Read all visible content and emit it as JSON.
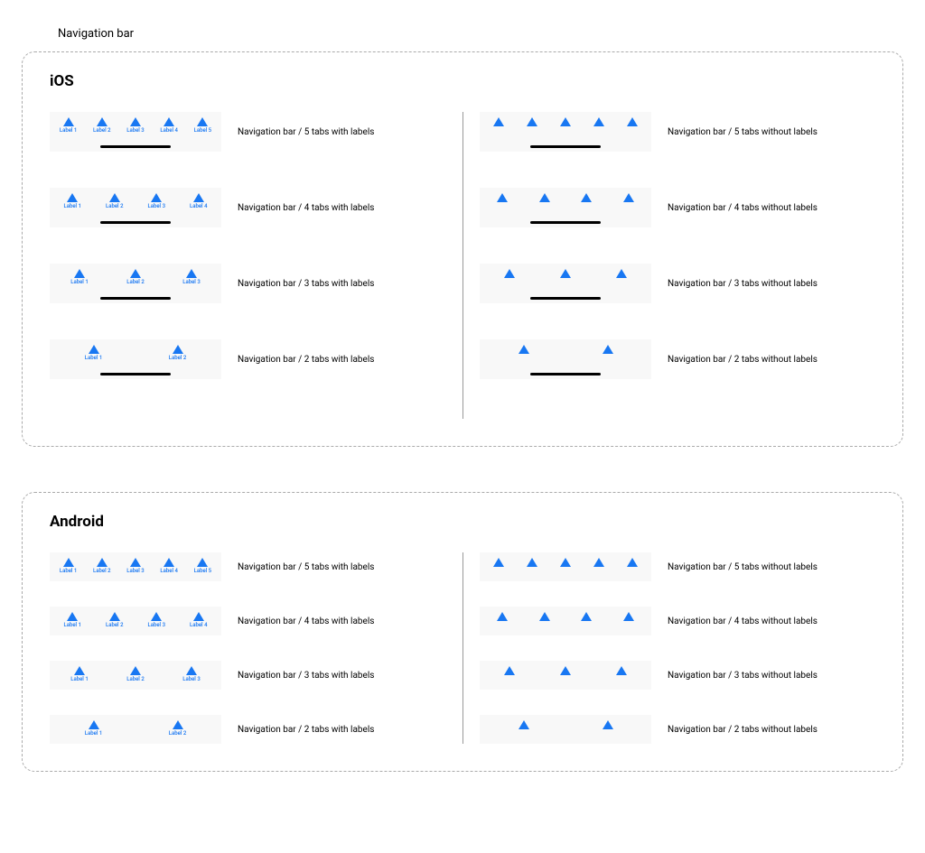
{
  "page_title": "Navigation bar",
  "tab_labels": [
    "Label 1",
    "Label 2",
    "Label 3",
    "Label 4",
    "Label 5"
  ],
  "icon_color": "#1877f2",
  "sections": [
    {
      "title": "iOS",
      "platform": "ios",
      "home_indicator": true,
      "rows": [
        {
          "count": 5,
          "with_label_caption": "Navigation bar / 5 tabs with labels",
          "without_label_caption": "Navigation bar / 5 tabs without labels"
        },
        {
          "count": 4,
          "with_label_caption": "Navigation bar / 4 tabs with labels",
          "without_label_caption": "Navigation bar / 4 tabs without labels"
        },
        {
          "count": 3,
          "with_label_caption": "Navigation bar / 3 tabs with labels",
          "without_label_caption": "Navigation bar / 3 tabs without labels"
        },
        {
          "count": 2,
          "with_label_caption": "Navigation bar / 2 tabs with labels",
          "without_label_caption": "Navigation bar / 2 tabs without labels"
        }
      ]
    },
    {
      "title": "Android",
      "platform": "android",
      "home_indicator": false,
      "rows": [
        {
          "count": 5,
          "with_label_caption": "Navigation bar / 5 tabs with labels",
          "without_label_caption": "Navigation bar / 5 tabs without labels"
        },
        {
          "count": 4,
          "with_label_caption": "Navigation bar / 4 tabs with labels",
          "without_label_caption": "Navigation bar / 4 tabs without labels"
        },
        {
          "count": 3,
          "with_label_caption": "Navigation bar / 3 tabs with labels",
          "without_label_caption": "Navigation bar / 3 tabs without labels"
        },
        {
          "count": 2,
          "with_label_caption": "Navigation bar / 2 tabs with labels",
          "without_label_caption": "Navigation bar / 2 tabs without labels"
        }
      ]
    }
  ]
}
